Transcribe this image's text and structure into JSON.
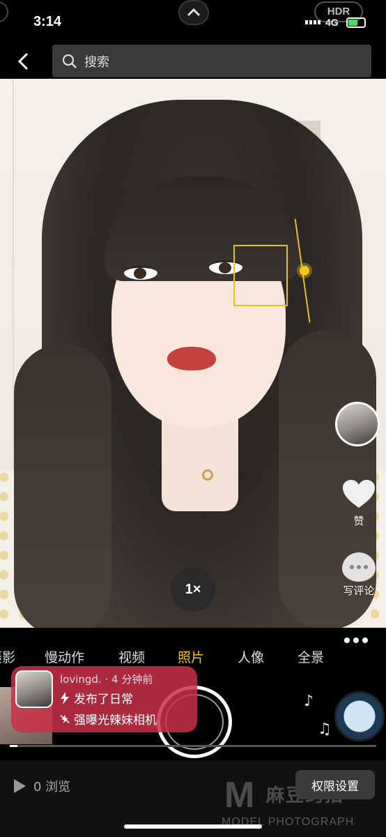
{
  "status_bar": {
    "time": "3:14",
    "hdr": "HDR",
    "network": "4G",
    "battery_color": "#4cd964"
  },
  "nav": {
    "back_icon": "chevron-left-icon",
    "search_placeholder": "搜索"
  },
  "camera": {
    "zoom_label": "1×",
    "focus_color": "#e9c022",
    "modes": [
      {
        "label": "摄影",
        "active": false
      },
      {
        "label": "慢动作",
        "active": false
      },
      {
        "label": "视频",
        "active": false
      },
      {
        "label": "照片",
        "active": true
      },
      {
        "label": "人像",
        "active": false
      },
      {
        "label": "全景",
        "active": false
      }
    ],
    "active_color": "#f5c518"
  },
  "side_actions": {
    "like_label": "赞",
    "comment_label": "写评论"
  },
  "activity": {
    "user": "lovingd. · 4 分钟前",
    "line1": "发布了日常",
    "line2": "强曝光辣妹相机",
    "bg_color": "#c83046"
  },
  "player": {
    "progress": 0.02
  },
  "footer": {
    "views": "0 浏览",
    "permission_button": "权限设置"
  },
  "watermark": {
    "logo_letter": "M",
    "brand_cn": "麻豆约拍",
    "brand_en": "MODEL PHOTOGRAPH"
  }
}
